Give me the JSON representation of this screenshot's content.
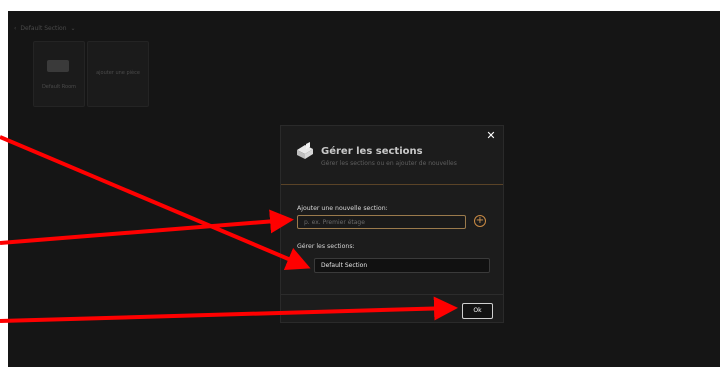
{
  "background": {
    "breadcrumb": "Default Section",
    "cards": [
      {
        "caption": "Default Room"
      },
      {
        "caption": "ajouter une pièce"
      }
    ]
  },
  "dialog": {
    "title": "Gérer les sections",
    "subtitle": "Gérer les sections ou en ajouter de nouvelles",
    "close_icon": "close-icon",
    "logo_icon": "house-3d-icon",
    "add_label": "Ajouter une nouvelle section:",
    "add_placeholder": "p. ex. Premier étage",
    "add_button_icon": "plus-circle-icon",
    "manage_label": "Gérer les sections:",
    "sections": [
      {
        "name": "Default Section"
      }
    ],
    "ok_label": "Ok"
  },
  "colors": {
    "app_bg": "#151515",
    "dialog_bg": "#1c1c1c",
    "accent": "#c98a44",
    "arrow": "#ff0000"
  }
}
